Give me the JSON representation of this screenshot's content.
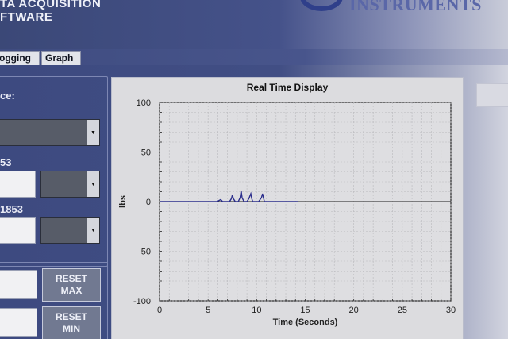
{
  "header": {
    "app_title": "TA ACQUISITION\nFTWARE",
    "brand_name": "INSTRUMENTS"
  },
  "tabs": [
    {
      "label": "ogging"
    },
    {
      "label": "Graph"
    }
  ],
  "left_panel": {
    "source_label": "ce:",
    "channel1_label": "53",
    "channel2_label": "1853",
    "reset_max_label": "RESET\nMAX",
    "reset_min_label": "RESET\nMIN"
  },
  "graph": {
    "title": "Real Time Display"
  },
  "chart_data": {
    "type": "line",
    "title": "Real Time Display",
    "xlabel": "Time (Seconds)",
    "ylabel": "lbs",
    "xlim": [
      0,
      30
    ],
    "ylim": [
      -100,
      100
    ],
    "xticks": [
      0,
      5,
      10,
      15,
      20,
      25,
      30
    ],
    "yticks": [
      100,
      50,
      0,
      -50,
      -100
    ],
    "grid": true,
    "colors": {
      "line": "#2c2f8c",
      "zero_line": "#1a1a1a",
      "grid": "#b9b9bd"
    },
    "series": [
      {
        "x": [
          0,
          5.9,
          6.1,
          6.3,
          6.5,
          7.2,
          7.4,
          7.5,
          7.6,
          7.8,
          8.1,
          8.3,
          8.4,
          8.5,
          8.7,
          9.0,
          9.2,
          9.4,
          9.5,
          9.6,
          9.8,
          10.2,
          10.5,
          10.6,
          10.7,
          10.8,
          11.0,
          14.3
        ],
        "y": [
          0,
          0,
          1,
          2,
          0,
          0,
          3,
          7,
          3,
          0,
          0,
          4,
          11,
          4,
          0,
          0,
          3,
          8,
          3,
          0,
          0,
          0,
          4,
          8,
          4,
          0,
          0,
          0
        ]
      }
    ]
  }
}
